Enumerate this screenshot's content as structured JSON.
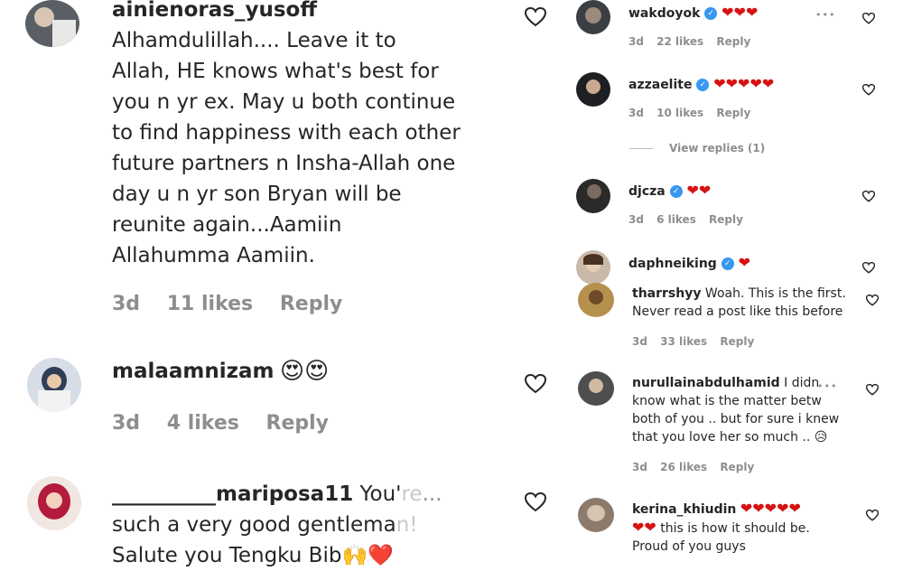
{
  "left": [
    {
      "username": "ainienoras_yusoff",
      "text_lines": [
        "Alhamdulillah.... Leave it to",
        "Allah, HE knows what's best for",
        "you n yr ex. May u both continue",
        "to find happiness with each other",
        "future partners n Insha-Allah one",
        "day u n yr son Bryan will be",
        "reunite again...Aamiin",
        "Allahumma Aamiin."
      ],
      "age": "3d",
      "likes": "11 likes",
      "reply": "Reply"
    },
    {
      "username": "malaamnizam",
      "emoji": "😍😍",
      "age": "3d",
      "likes": "4 likes",
      "reply": "Reply"
    },
    {
      "username": "__________mariposa11",
      "text_start": "You'",
      "text_faded": "re",
      "ellipsis": "...",
      "line2": "such a very good gentlema",
      "line2_faded": "n!",
      "line3": "Salute you Tengku Bib",
      "line3_emoji": "🙌❤️"
    }
  ],
  "right": [
    {
      "username": "wakdoyok",
      "hearts": "❤❤❤",
      "more": "•••",
      "age": "3d",
      "likes": "22 likes",
      "reply": "Reply"
    },
    {
      "username": "azzaelite",
      "hearts": "❤❤❤❤❤",
      "age": "3d",
      "likes": "10 likes",
      "reply": "Reply",
      "view_replies": "View replies (1)"
    },
    {
      "username": "djcza",
      "hearts": "❤❤",
      "age": "3d",
      "likes": "6 likes",
      "reply": "Reply"
    },
    {
      "username": "daphneiking",
      "hearts": "❤"
    },
    {
      "username": "tharrshyy",
      "text": "Woah. This is the first.",
      "line2": "Never read a post like this before",
      "age": "3d",
      "likes": "33 likes",
      "reply": "Reply"
    },
    {
      "username": "nurullainabdulhamid",
      "text": "I didn",
      "more": "•••",
      "line2": "know what is the matter betw",
      "line3": "both of you .. but for sure i knew",
      "line4": "that you love her so much ..",
      "emoji": "😥",
      "age": "3d",
      "likes": "26 likes",
      "reply": "Reply"
    },
    {
      "username": "kerina_khiudin",
      "hearts": "❤❤❤❤❤",
      "hearts2": "❤❤",
      "text": "this is how it should be.",
      "line2": "Proud of you guys"
    }
  ],
  "icons": {
    "like": "heart-outline-icon",
    "verified": "verified-badge-icon"
  },
  "colors": {
    "heart": "#d51313",
    "verified": "#3897f0",
    "meta": "#8e8e8e",
    "text": "#262626"
  }
}
